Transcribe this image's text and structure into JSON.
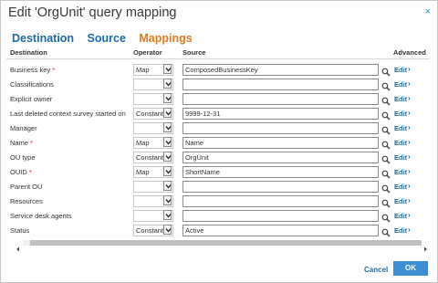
{
  "dialog": {
    "title": "Edit 'OrgUnit' query mapping",
    "close_glyph": "×"
  },
  "tabs": [
    {
      "label": "Destination",
      "active": false
    },
    {
      "label": "Source",
      "active": false
    },
    {
      "label": "Mappings",
      "active": true
    }
  ],
  "columns": {
    "destination": "Destination",
    "operator": "Operator",
    "source": "Source",
    "advanced": "Advanced"
  },
  "rows": [
    {
      "label": "Business key",
      "required": true,
      "operator": "Map",
      "source": "ComposedBusinessKey"
    },
    {
      "label": "Classifications",
      "required": false,
      "operator": "",
      "source": ""
    },
    {
      "label": "Explicit owner",
      "required": false,
      "operator": "",
      "source": ""
    },
    {
      "label": "Last deleted context survey started on",
      "required": false,
      "operator": "Constant",
      "source": "9999-12-31"
    },
    {
      "label": "Manager",
      "required": false,
      "operator": "",
      "source": ""
    },
    {
      "label": "Name",
      "required": true,
      "operator": "Map",
      "source": "Name"
    },
    {
      "label": "OU type",
      "required": false,
      "operator": "Constant",
      "source": "OrgUnit"
    },
    {
      "label": "OUID",
      "required": true,
      "operator": "Map",
      "source": "ShortName"
    },
    {
      "label": "Parent OU",
      "required": false,
      "operator": "",
      "source": ""
    },
    {
      "label": "Resources",
      "required": false,
      "operator": "",
      "source": ""
    },
    {
      "label": "Service desk agents",
      "required": false,
      "operator": "",
      "source": ""
    },
    {
      "label": "Status",
      "required": false,
      "operator": "Constant",
      "source": "Active"
    }
  ],
  "required_marker": "*",
  "edit_label": "Edit",
  "edit_chevron": "›",
  "buttons": {
    "cancel": "Cancel",
    "ok": "OK"
  },
  "colors": {
    "accent_blue": "#1e6ea6",
    "active_tab_orange": "#e07b1f",
    "required_red": "#d9232a",
    "ok_button": "#3d8fd1"
  },
  "icons": {
    "search": "search-icon",
    "dropdown": "chevron-down-icon",
    "close": "close-icon"
  }
}
